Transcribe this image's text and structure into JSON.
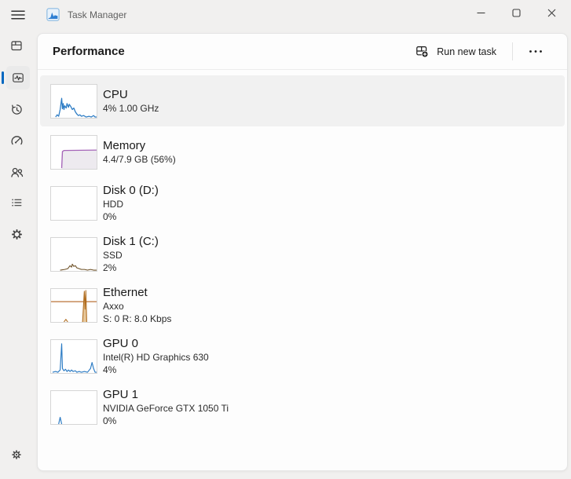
{
  "titlebar": {
    "app_title": "Task Manager",
    "app_icon": "task-manager-logo",
    "controls": [
      "minimize",
      "maximize",
      "close"
    ]
  },
  "page": {
    "title": "Performance"
  },
  "toolbar": {
    "run_new_task_label": "Run new task",
    "run_new_task_icon": "new-window-plus-icon",
    "more_icon": "ellipsis-icon"
  },
  "sidebar": {
    "selected": "performance",
    "accent_color": "#0067c0",
    "items": [
      "processes",
      "performance",
      "app-history",
      "startup-apps",
      "users",
      "details",
      "services"
    ],
    "bottom_item": "settings"
  },
  "colors": {
    "cpu_gpu_blue": "#2b7bc4",
    "memory_purple": "#a565b8",
    "memory_fill": "#edeaef",
    "disk_brown": "#6d5026",
    "ethernet_orange": "#c0804a",
    "ethernet_spike": "#b06c1e",
    "selection_gray": "#f1f1f1"
  },
  "performance_items": [
    {
      "id": "cpu",
      "name": "CPU",
      "lines": [
        "4% 1.00 GHz"
      ],
      "selected": true,
      "graph": [
        {
          "stroke": "#2b7bc4",
          "width": 1.3,
          "points": [
            [
              6,
              43
            ],
            [
              8,
              40
            ],
            [
              10,
              42
            ],
            [
              12,
              33
            ],
            [
              14,
              18
            ],
            [
              15,
              32
            ],
            [
              16,
              25
            ],
            [
              17,
              33
            ],
            [
              18,
              28
            ],
            [
              20,
              31
            ],
            [
              21,
              25
            ],
            [
              23,
              30
            ],
            [
              24,
              26
            ],
            [
              26,
              29
            ],
            [
              28,
              33
            ],
            [
              30,
              31
            ],
            [
              32,
              36
            ],
            [
              34,
              39
            ],
            [
              36,
              41
            ],
            [
              38,
              40
            ],
            [
              40,
              42
            ],
            [
              43,
              41
            ],
            [
              46,
              43
            ],
            [
              50,
              42
            ],
            [
              53,
              43
            ],
            [
              56,
              41
            ],
            [
              58,
              43
            ],
            [
              60,
              43
            ]
          ]
        }
      ]
    },
    {
      "id": "memory",
      "name": "Memory",
      "lines": [
        "4.4/7.9 GB (56%)"
      ],
      "selected": false,
      "graph": [
        {
          "fill": "#edeaef",
          "close": true,
          "points": [
            [
              14,
              44
            ],
            [
              15,
              21
            ],
            [
              17,
              19.5
            ],
            [
              60,
              19
            ]
          ]
        },
        {
          "stroke": "#a565b8",
          "width": 1.4,
          "points": [
            [
              14,
              43
            ],
            [
              15,
              21
            ],
            [
              17,
              19.5
            ],
            [
              60,
              19
            ]
          ]
        }
      ]
    },
    {
      "id": "disk0",
      "name": "Disk 0 (D:)",
      "lines": [
        "HDD",
        "0%"
      ],
      "selected": false,
      "graph": []
    },
    {
      "id": "disk1",
      "name": "Disk 1 (C:)",
      "lines": [
        "SSD",
        "2%"
      ],
      "selected": false,
      "graph": [
        {
          "stroke": "#6d5026",
          "width": 1.1,
          "points": [
            [
              12,
              43
            ],
            [
              18,
              42
            ],
            [
              22,
              41
            ],
            [
              25,
              37
            ],
            [
              27,
              39
            ],
            [
              28,
              35
            ],
            [
              30,
              38
            ],
            [
              32,
              37
            ],
            [
              34,
              40
            ],
            [
              37,
              41
            ],
            [
              40,
              42
            ],
            [
              44,
              42
            ],
            [
              48,
              43
            ],
            [
              52,
              42
            ],
            [
              56,
              43
            ],
            [
              60,
              43
            ]
          ]
        }
      ]
    },
    {
      "id": "ethernet",
      "name": "Ethernet",
      "lines": [
        "Axxo",
        "S: 0 R: 8.0 Kbps"
      ],
      "selected": false,
      "graph": [
        {
          "stroke": "#c0804a",
          "width": 1.4,
          "points": [
            [
              0,
              17
            ],
            [
              60,
              17
            ]
          ]
        },
        {
          "stroke": "#b06c1e",
          "width": 1.1,
          "points": [
            [
              17,
              44
            ],
            [
              19.5,
              40.5
            ],
            [
              22,
              44
            ]
          ]
        },
        {
          "fill": "#e7c79a",
          "close": true,
          "points": [
            [
              41.5,
              44
            ],
            [
              43.8,
              3
            ],
            [
              44.8,
              27
            ],
            [
              45.8,
              2
            ],
            [
              47,
              44
            ]
          ]
        },
        {
          "stroke": "#b06c1e",
          "width": 1.1,
          "points": [
            [
              41.5,
              44
            ],
            [
              43.8,
              3
            ],
            [
              44.8,
              27
            ],
            [
              45.8,
              2
            ],
            [
              47,
              44
            ]
          ]
        }
      ]
    },
    {
      "id": "gpu0",
      "name": "GPU 0",
      "lines": [
        "Intel(R) HD Graphics 630",
        "4%"
      ],
      "selected": false,
      "graph": [
        {
          "stroke": "#2b7bc4",
          "width": 1.2,
          "points": [
            [
              2,
              43
            ],
            [
              6,
              42
            ],
            [
              9,
              43
            ],
            [
              12,
              40
            ],
            [
              14,
              5
            ],
            [
              15,
              38
            ],
            [
              17,
              41
            ],
            [
              19,
              39
            ],
            [
              21,
              42
            ],
            [
              23,
              40
            ],
            [
              25,
              42
            ],
            [
              27,
              40
            ],
            [
              29,
              42
            ],
            [
              32,
              41
            ],
            [
              34,
              43
            ],
            [
              37,
              42
            ],
            [
              40,
              43
            ],
            [
              44,
              42
            ],
            [
              48,
              43
            ],
            [
              52,
              38
            ],
            [
              54,
              30
            ],
            [
              56,
              38
            ],
            [
              58,
              43
            ],
            [
              60,
              43
            ]
          ]
        }
      ]
    },
    {
      "id": "gpu1",
      "name": "GPU 1",
      "lines": [
        "NVIDIA GeForce GTX 1050 Ti",
        "0%"
      ],
      "selected": false,
      "graph": [
        {
          "stroke": "#2b7bc4",
          "width": 1.2,
          "points": [
            [
              10,
              44
            ],
            [
              12,
              35
            ],
            [
              14,
              44
            ]
          ]
        }
      ]
    }
  ]
}
